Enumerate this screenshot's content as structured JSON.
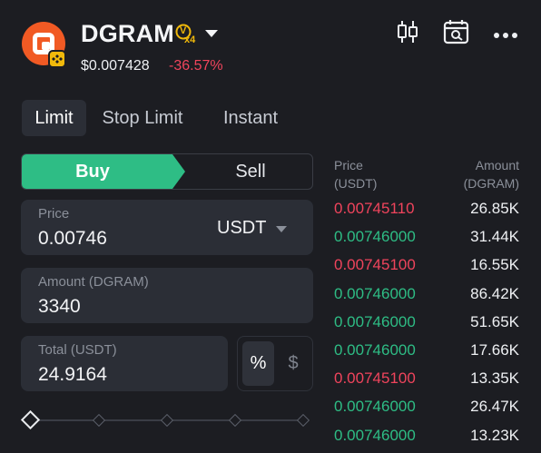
{
  "token": {
    "name": "DGRAM",
    "verify_badge": "V",
    "multiplier": "x4",
    "price": "$0.007428",
    "change": "-36.57%",
    "logo_icon": "dgram-logo-icon",
    "chain_icon": "bnb-chain-icon"
  },
  "header_icons": [
    "candlestick-chart-icon",
    "calendar-search-icon",
    "more-icon"
  ],
  "tabs": [
    {
      "label": "Limit",
      "active": true
    },
    {
      "label": "Stop Limit",
      "active": false
    },
    {
      "label": "Instant",
      "active": false
    }
  ],
  "side": {
    "buy_label": "Buy",
    "sell_label": "Sell",
    "selected": "Buy"
  },
  "price_field": {
    "label": "Price",
    "value": "0.00746",
    "unit": "USDT"
  },
  "amount_field": {
    "label": "Amount (DGRAM)",
    "value": "3340"
  },
  "total_field": {
    "label": "Total (USDT)",
    "value": "24.9164"
  },
  "total_toggle": {
    "percent": "%",
    "dollar": "$",
    "selected": "%"
  },
  "slider": {
    "value_percent": 0
  },
  "order_book": {
    "price_header": [
      "Price",
      "(USDT)"
    ],
    "amount_header": [
      "Amount",
      "(DGRAM)"
    ],
    "rows": [
      {
        "price": "0.00745110",
        "amount": "26.85K",
        "side": "sell"
      },
      {
        "price": "0.00746000",
        "amount": "31.44K",
        "side": "buy"
      },
      {
        "price": "0.00745100",
        "amount": "16.55K",
        "side": "sell"
      },
      {
        "price": "0.00746000",
        "amount": "86.42K",
        "side": "buy"
      },
      {
        "price": "0.00746000",
        "amount": "51.65K",
        "side": "buy"
      },
      {
        "price": "0.00746000",
        "amount": "17.66K",
        "side": "buy"
      },
      {
        "price": "0.00745100",
        "amount": "13.35K",
        "side": "sell"
      },
      {
        "price": "0.00746000",
        "amount": "26.47K",
        "side": "buy"
      },
      {
        "price": "0.00746000",
        "amount": "13.23K",
        "side": "buy"
      }
    ]
  },
  "colors": {
    "buy": "#2ebd85",
    "sell": "#f0445c",
    "background": "#1c1d22",
    "field": "#2b2e36"
  }
}
